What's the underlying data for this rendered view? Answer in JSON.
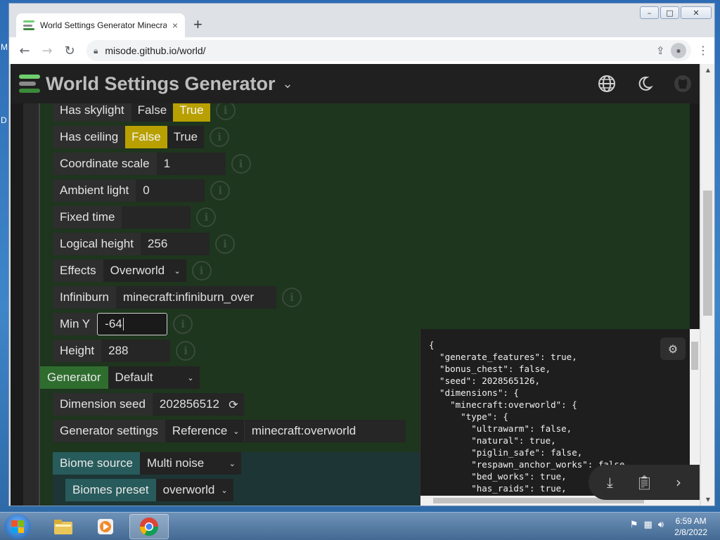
{
  "desktop": {
    "edge_letters": [
      "M",
      "D"
    ]
  },
  "browser": {
    "tab_title": "World Settings Generator Minecraft",
    "tab_close": "×",
    "new_tab": "+",
    "url": "misode.github.io/world/",
    "window_controls": {
      "minimize": "–",
      "maximize": "□",
      "close": "✕"
    }
  },
  "app": {
    "title": "World Settings Generator",
    "colors": {
      "logo_top": "#6fcf6f",
      "logo_mid": "#8a8a8a",
      "logo_bottom": "#3a8a3a",
      "selected_option": "#b8a000",
      "generator_label": "#2f6d2f",
      "biome_label": "#285b5b"
    },
    "icons": [
      "language-icon",
      "dark-mode-moon-icon",
      "github-icon"
    ]
  },
  "settings": {
    "has_skylight": {
      "label": "Has skylight",
      "options": [
        "False",
        "True"
      ],
      "selected": "True"
    },
    "has_ceiling": {
      "label": "Has ceiling",
      "options": [
        "False",
        "True"
      ],
      "selected": "False"
    },
    "coordinate_scale": {
      "label": "Coordinate scale",
      "value": "1"
    },
    "ambient_light": {
      "label": "Ambient light",
      "value": "0"
    },
    "fixed_time": {
      "label": "Fixed time",
      "value": ""
    },
    "logical_height": {
      "label": "Logical height",
      "value": "256"
    },
    "effects": {
      "label": "Effects",
      "value": "Overworld"
    },
    "infiniburn": {
      "label": "Infiniburn",
      "value": "minecraft:infiniburn_over"
    },
    "min_y": {
      "label": "Min Y",
      "value": "-64"
    },
    "height": {
      "label": "Height",
      "value": "288"
    },
    "generator": {
      "label": "Generator",
      "value": "Default"
    },
    "dimension_seed": {
      "label": "Dimension seed",
      "value": "202856512"
    },
    "generator_settings": {
      "label": "Generator settings",
      "mode": "Reference",
      "value": "minecraft:overworld"
    },
    "biome_source": {
      "label": "Biome source",
      "value": "Multi noise"
    },
    "biomes_preset": {
      "label": "Biomes preset",
      "value": "overworld"
    },
    "info_glyph": "i"
  },
  "json_preview": {
    "lines": [
      "{",
      "  \"generate_features\": true,",
      "  \"bonus_chest\": false,",
      "  \"seed\": 2028565126,",
      "  \"dimensions\": {",
      "    \"minecraft:overworld\": {",
      "      \"type\": {",
      "        \"ultrawarm\": false,",
      "        \"natural\": true,",
      "        \"piglin_safe\": false,",
      "        \"respawn_anchor_works\": false,",
      "        \"bed_works\": true,",
      "        \"has_raids\": true,"
    ],
    "actions": [
      "download-icon",
      "copy-clipboard-icon",
      "chevron-right-icon"
    ]
  },
  "taskbar": {
    "time": "6:59 AM",
    "date": "2/8/2022"
  }
}
